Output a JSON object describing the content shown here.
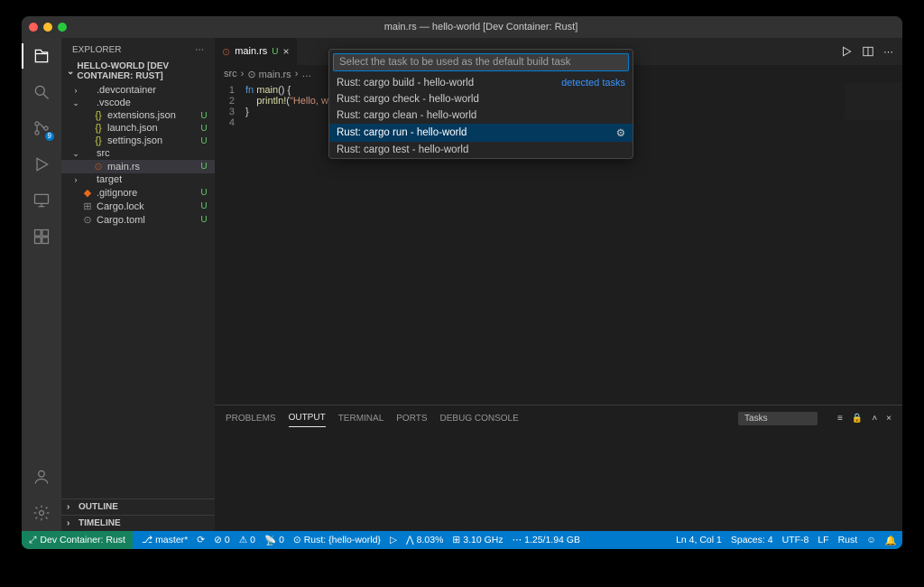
{
  "window_title": "main.rs — hello-world [Dev Container: Rust]",
  "explorer_title": "EXPLORER",
  "more_glyph": "⋯",
  "project_section": "HELLO-WORLD [DEV CONTAINER: RUST]",
  "tree": [
    {
      "indent": 10,
      "chev": "›",
      "icon": "",
      "iclass": "",
      "label": ".devcontainer",
      "status": ""
    },
    {
      "indent": 10,
      "chev": "⌄",
      "icon": "",
      "iclass": "",
      "label": ".vscode",
      "status": ""
    },
    {
      "indent": 22,
      "chev": "",
      "icon": "{}",
      "iclass": "fi-json",
      "label": "extensions.json",
      "status": "U"
    },
    {
      "indent": 22,
      "chev": "",
      "icon": "{}",
      "iclass": "fi-json",
      "label": "launch.json",
      "status": "U"
    },
    {
      "indent": 22,
      "chev": "",
      "icon": "{}",
      "iclass": "fi-json",
      "label": "settings.json",
      "status": "U"
    },
    {
      "indent": 10,
      "chev": "⌄",
      "icon": "",
      "iclass": "",
      "label": "src",
      "status": ""
    },
    {
      "indent": 22,
      "chev": "",
      "icon": "⊙",
      "iclass": "fi-rust",
      "label": "main.rs",
      "status": "U",
      "selected": true
    },
    {
      "indent": 10,
      "chev": "›",
      "icon": "",
      "iclass": "",
      "label": "target",
      "status": ""
    },
    {
      "indent": 10,
      "chev": "",
      "icon": "◆",
      "iclass": "fi-git",
      "label": ".gitignore",
      "status": "U"
    },
    {
      "indent": 10,
      "chev": "",
      "icon": "⊞",
      "iclass": "fi-lock",
      "label": "Cargo.lock",
      "status": "U"
    },
    {
      "indent": 10,
      "chev": "",
      "icon": "⊙",
      "iclass": "fi-toml",
      "label": "Cargo.toml",
      "status": "U"
    }
  ],
  "outline_label": "OUTLINE",
  "timeline_label": "TIMELINE",
  "tab": {
    "icon": "⊙",
    "label": "main.rs",
    "dirty": "U"
  },
  "breadcrumb": [
    "src",
    "⊙ main.rs",
    "…"
  ],
  "code_lines": [
    "1|fn |main|() {",
    "2|    |println!|(|\"Hello, w",
    "3|}",
    "4|"
  ],
  "code_render": [
    {
      "no": "1",
      "html": "<span class='kw'>fn</span> <span class='fn'>main</span>() {"
    },
    {
      "no": "2",
      "html": "    <span class='mac'>println!</span>(<span class='str'>\"Hello, w</span>"
    },
    {
      "no": "3",
      "html": "}"
    },
    {
      "no": "4",
      "html": ""
    }
  ],
  "quickpick": {
    "placeholder": "Select the task to be used as the default build task",
    "detected_label": "detected tasks",
    "items": [
      {
        "label": "Rust: cargo build - hello-world"
      },
      {
        "label": "Rust: cargo check - hello-world"
      },
      {
        "label": "Rust: cargo clean - hello-world"
      },
      {
        "label": "Rust: cargo run - hello-world",
        "selected": true,
        "gear": true
      },
      {
        "label": "Rust: cargo test - hello-world"
      }
    ]
  },
  "panel": {
    "tabs": [
      "PROBLEMS",
      "OUTPUT",
      "TERMINAL",
      "PORTS",
      "DEBUG CONSOLE"
    ],
    "active": "OUTPUT",
    "selector": "Tasks"
  },
  "status": {
    "remote": "Dev Container: Rust",
    "branch": "master*",
    "sync": "⟳",
    "errors": "0",
    "warnings": "0",
    "ports": "0",
    "run_target": "Rust: {hello-world}",
    "cpu": "8.03%",
    "ghz": "3.10 GHz",
    "mem": "1.25/1.94 GB",
    "lncol": "Ln 4, Col 1",
    "spaces": "Spaces: 4",
    "encoding": "UTF-8",
    "eol": "LF",
    "lang": "Rust"
  }
}
